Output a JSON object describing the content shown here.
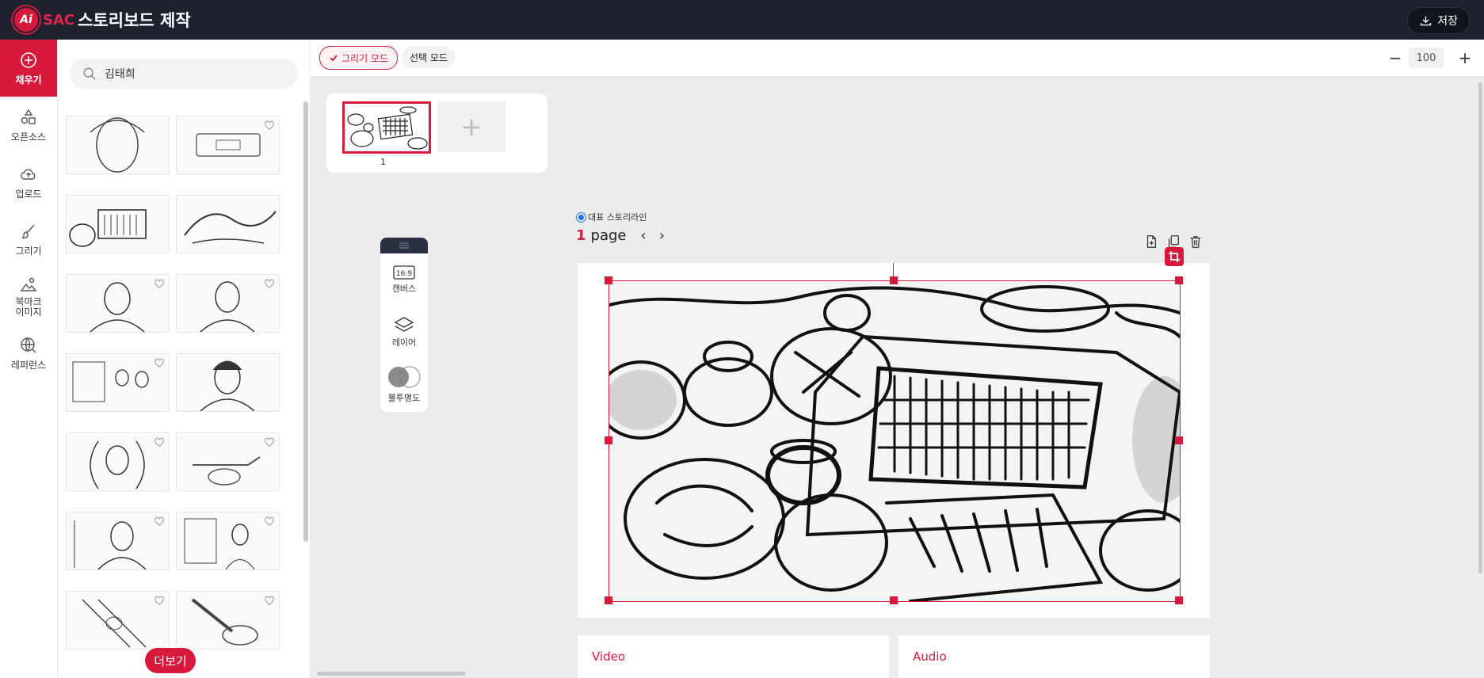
{
  "header": {
    "logo_text": "Ai",
    "brand": "SAC",
    "title": "스토리보드 제작",
    "save_label": "저장"
  },
  "nav": {
    "items": [
      {
        "label": "채우기",
        "icon": "plus-circle-icon",
        "active": true
      },
      {
        "label": "오픈소스",
        "icon": "shapes-icon"
      },
      {
        "label": "업로드",
        "icon": "cloud-upload-icon"
      },
      {
        "label": "그리기",
        "icon": "brush-icon"
      },
      {
        "label": "북마크\n이미지",
        "icon": "bookmark-image-icon"
      },
      {
        "label": "레퍼런스",
        "icon": "globe-search-icon"
      }
    ]
  },
  "panel": {
    "search": {
      "value": "김태희",
      "placeholder": ""
    },
    "more_label": "더보기"
  },
  "toolbar": {
    "draw_mode": "그리기 모드",
    "select_mode": "선택 모드",
    "zoom": "100",
    "zoom_minus": "−",
    "zoom_plus": "+"
  },
  "pages": {
    "items": [
      "1"
    ],
    "add_symbol": "+"
  },
  "tools": {
    "canvas_ratio": "16:9",
    "canvas": "캔버스",
    "layer": "레이어",
    "opacity": "불투명도"
  },
  "editor": {
    "representative": "대표 스토리라인",
    "page_number": "1",
    "page_word": "page",
    "prev": "‹",
    "next": "›"
  },
  "cards": {
    "video": "Video",
    "audio": "Audio"
  },
  "colors": {
    "accent": "#d8193c",
    "topbar": "#1e2230"
  }
}
